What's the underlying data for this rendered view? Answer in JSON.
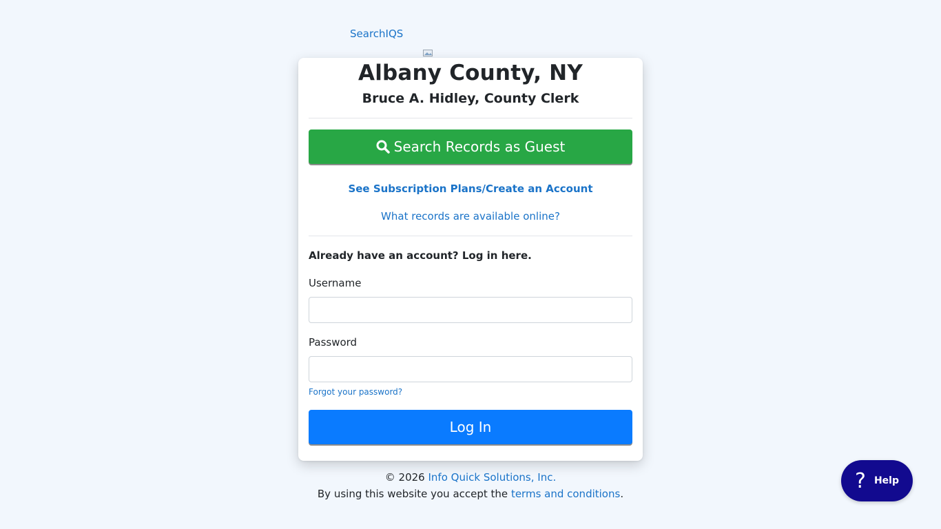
{
  "logo": {
    "alt_text": "SearchIQS",
    "icon": "broken-image-icon"
  },
  "header": {
    "title": "Albany County, NY",
    "subtitle": "Bruce A. Hidley, County Clerk"
  },
  "guest": {
    "button_label": "Search Records as Guest",
    "icon": "search-icon"
  },
  "links": {
    "subscription": "See Subscription Plans/Create an Account",
    "records_available": "What records are available online?"
  },
  "login": {
    "heading": "Already have an account? Log in here.",
    "username_label": "Username",
    "username_value": "",
    "password_label": "Password",
    "password_value": "",
    "forgot_link": "Forgot your password?",
    "submit_label": "Log In"
  },
  "footer": {
    "copyright_prefix": "© 2026 ",
    "company_link": "Info Quick Solutions, Inc.",
    "terms_prefix": "By using this website you accept the ",
    "terms_link": "terms and conditions",
    "terms_suffix": "."
  },
  "help": {
    "icon": "question-icon",
    "label": "Help"
  },
  "colors": {
    "background": "#f2f7fd",
    "guest_button": "#28a745",
    "login_button": "#0a7bff",
    "link": "#1a73c8",
    "help_button": "#120a8f"
  }
}
